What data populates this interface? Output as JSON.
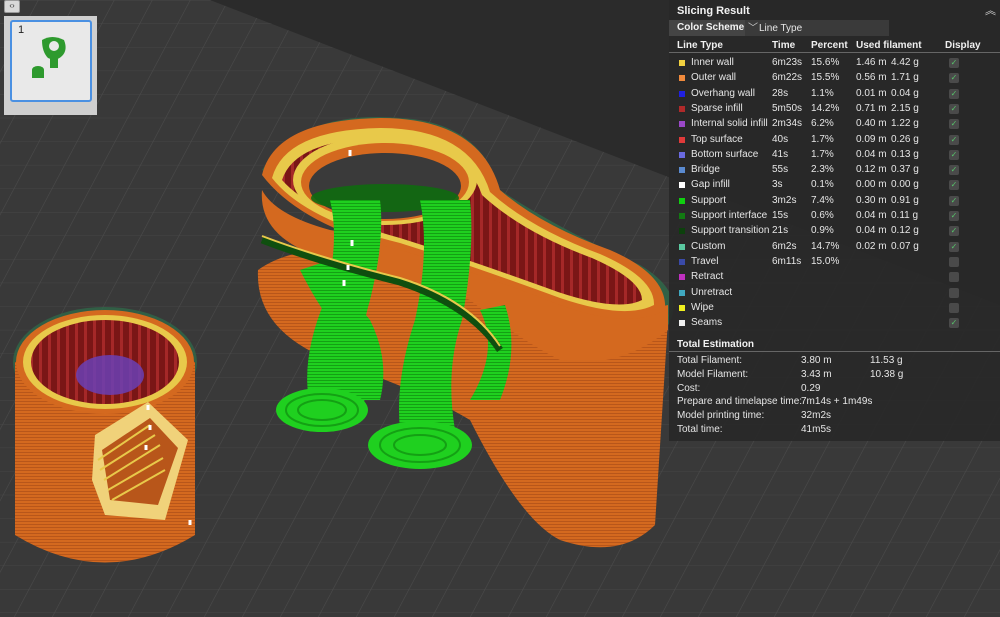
{
  "scene": {
    "description_icon": "3d-print-preview",
    "colors": {
      "background": "#2b2b2b",
      "plate": "#3a3a3a",
      "grid": "#4a4a4a",
      "outer_wall": "#d2691e",
      "inner_wall": "#e8c94a",
      "sparse_infill": "#8b1a1a",
      "support": "#22cc22",
      "support_interface": "#0f6b0f",
      "internal_solid": "#6a3fb5",
      "shell_glow": "#3b7a57"
    }
  },
  "thumbnail": {
    "index": "1",
    "collapse_icon": "collapse-arrows-icon"
  },
  "panel": {
    "title": "Slicing Result",
    "color_scheme_label": "Color Scheme",
    "color_scheme_value": "Line Type",
    "headers": {
      "line_type": "Line Type",
      "time": "Time",
      "percent": "Percent",
      "used_filament": "Used filament",
      "display": "Display"
    },
    "rows": [
      {
        "name": "Inner wall",
        "color": "#f0d040",
        "time": "6m23s",
        "percent": "15.6%",
        "len": "1.46 m",
        "weight": "4.42 g",
        "display": true
      },
      {
        "name": "Outer wall",
        "color": "#f08a3c",
        "time": "6m22s",
        "percent": "15.5%",
        "len": "0.56 m",
        "weight": "1.71 g",
        "display": true
      },
      {
        "name": "Overhang wall",
        "color": "#2020e0",
        "time": "28s",
        "percent": "1.1%",
        "len": "0.01 m",
        "weight": "0.04 g",
        "display": true
      },
      {
        "name": "Sparse infill",
        "color": "#b02a2a",
        "time": "5m50s",
        "percent": "14.2%",
        "len": "0.71 m",
        "weight": "2.15 g",
        "display": true
      },
      {
        "name": "Internal solid infill",
        "color": "#9a48c8",
        "time": "2m34s",
        "percent": "6.2%",
        "len": "0.40 m",
        "weight": "1.22 g",
        "display": true
      },
      {
        "name": "Top surface",
        "color": "#e03a3a",
        "time": "40s",
        "percent": "1.7%",
        "len": "0.09 m",
        "weight": "0.26 g",
        "display": true
      },
      {
        "name": "Bottom surface",
        "color": "#6a6ae0",
        "time": "41s",
        "percent": "1.7%",
        "len": "0.04 m",
        "weight": "0.13 g",
        "display": true
      },
      {
        "name": "Bridge",
        "color": "#5a8ad0",
        "time": "55s",
        "percent": "2.3%",
        "len": "0.12 m",
        "weight": "0.37 g",
        "display": true
      },
      {
        "name": "Gap infill",
        "color": "#ffffff",
        "time": "3s",
        "percent": "0.1%",
        "len": "0.00 m",
        "weight": "0.00 g",
        "display": true
      },
      {
        "name": "Support",
        "color": "#10d010",
        "time": "3m2s",
        "percent": "7.4%",
        "len": "0.30 m",
        "weight": "0.91 g",
        "display": true
      },
      {
        "name": "Support interface",
        "color": "#127a12",
        "time": "15s",
        "percent": "0.6%",
        "len": "0.04 m",
        "weight": "0.11 g",
        "display": true
      },
      {
        "name": "Support transition",
        "color": "#0c400c",
        "time": "21s",
        "percent": "0.9%",
        "len": "0.04 m",
        "weight": "0.12 g",
        "display": true
      },
      {
        "name": "Custom",
        "color": "#5ac8a0",
        "time": "6m2s",
        "percent": "14.7%",
        "len": "0.02 m",
        "weight": "0.07 g",
        "display": true
      },
      {
        "name": "Travel",
        "color": "#3a4aa8",
        "time": "6m11s",
        "percent": "15.0%",
        "len": "",
        "weight": "",
        "display": false
      },
      {
        "name": "Retract",
        "color": "#c030c0",
        "time": "",
        "percent": "",
        "len": "",
        "weight": "",
        "display": false
      },
      {
        "name": "Unretract",
        "color": "#40a8c0",
        "time": "",
        "percent": "",
        "len": "",
        "weight": "",
        "display": false
      },
      {
        "name": "Wipe",
        "color": "#f0f020",
        "time": "",
        "percent": "",
        "len": "",
        "weight": "",
        "display": false
      },
      {
        "name": "Seams",
        "color": "#f0f0f0",
        "time": "",
        "percent": "",
        "len": "",
        "weight": "",
        "display": true
      }
    ],
    "estimation_title": "Total Estimation",
    "estimation": [
      {
        "label": "Total Filament:",
        "v1": "3.80 m",
        "v2": "11.53 g"
      },
      {
        "label": "Model Filament:",
        "v1": "3.43 m",
        "v2": "10.38 g"
      },
      {
        "label": "Cost:",
        "v1": "0.29",
        "v2": ""
      },
      {
        "label": "Prepare and timelapse time:",
        "v1": "7m14s + 1m49s",
        "v2": ""
      },
      {
        "label": "Model printing time:",
        "v1": "32m2s",
        "v2": ""
      },
      {
        "label": "Total time:",
        "v1": "41m5s",
        "v2": ""
      }
    ]
  }
}
